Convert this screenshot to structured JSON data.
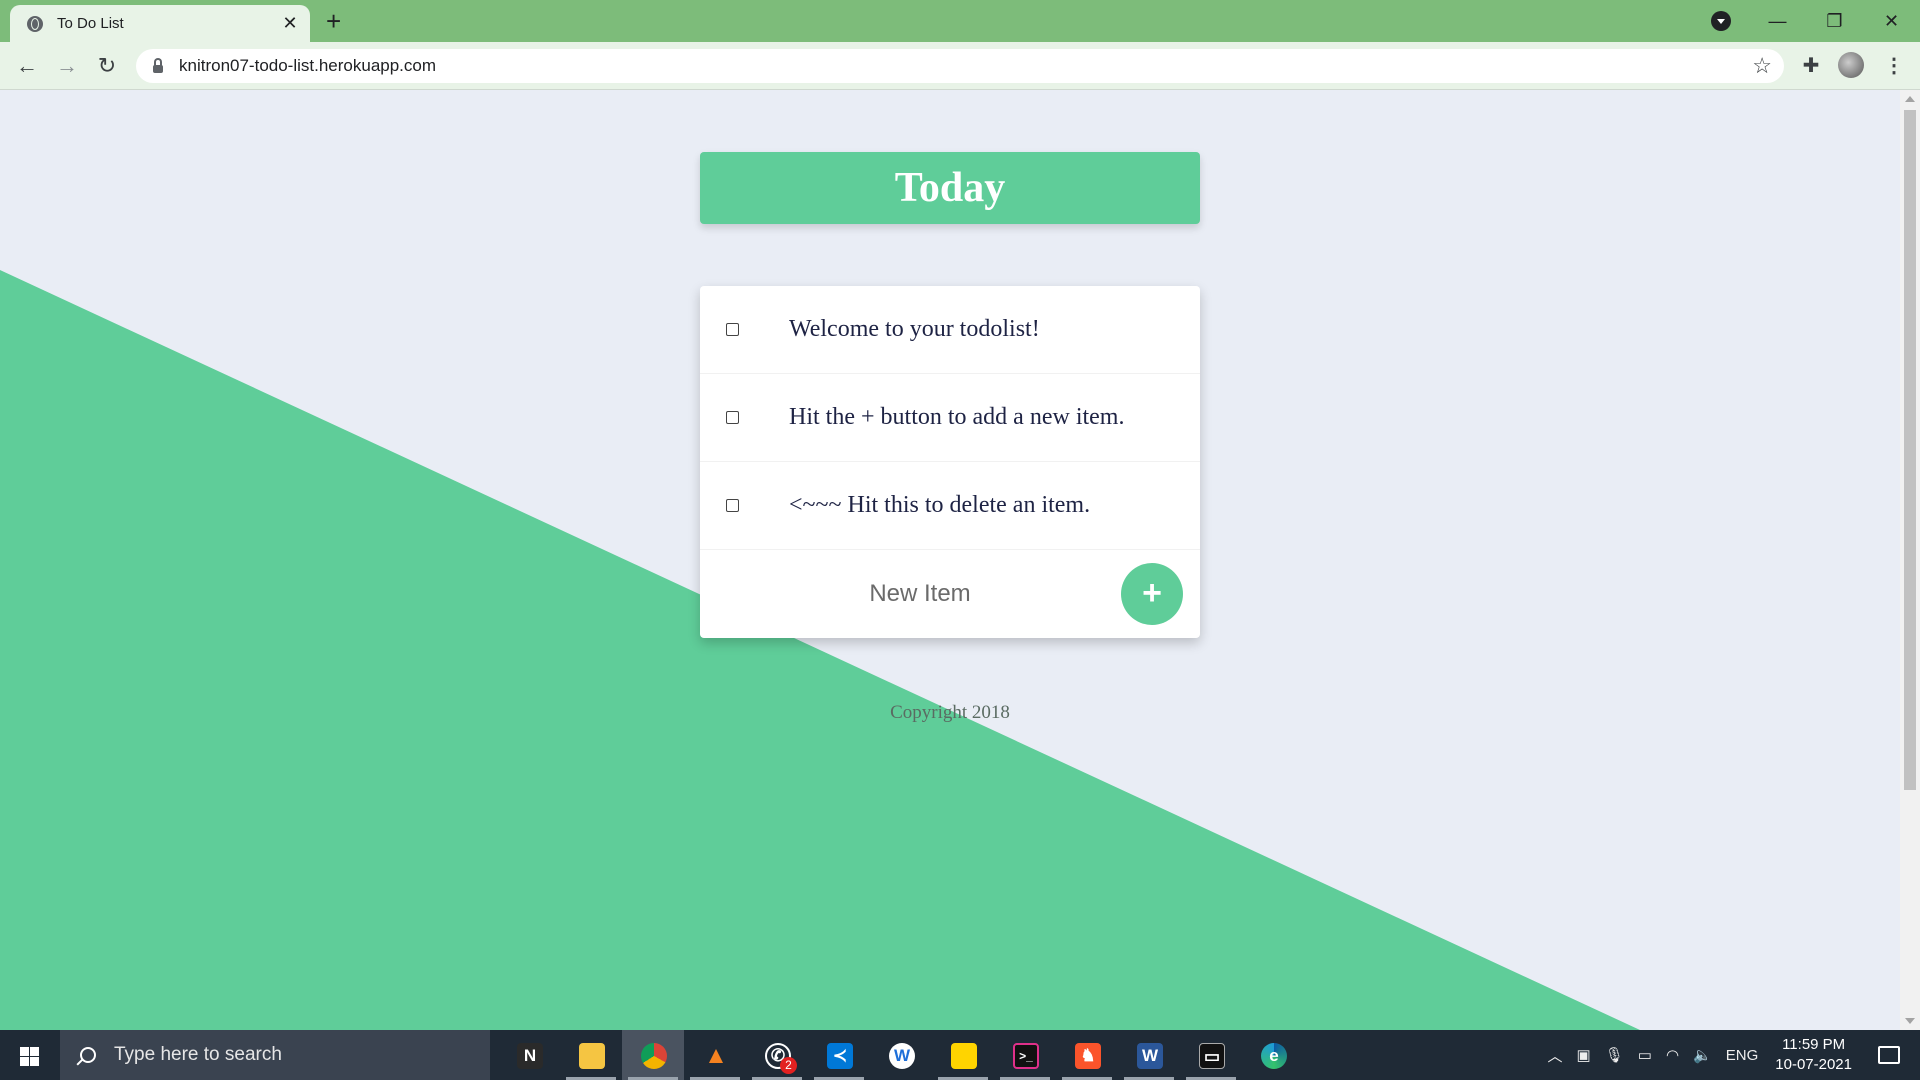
{
  "browser": {
    "tab_title": "To Do List",
    "tab_close": "✕",
    "new_tab": "+",
    "url": "knitron07-todo-list.herokuapp.com",
    "window_controls": {
      "minimize": "—",
      "restore": "❐",
      "close": "✕"
    }
  },
  "app": {
    "title": "Today",
    "items": [
      {
        "text": "Welcome to your todolist!",
        "checked": false
      },
      {
        "text": "Hit the + button to add a new item.",
        "checked": false
      },
      {
        "text": "<~~~ Hit this to delete an item.",
        "checked": false
      }
    ],
    "new_item_placeholder": "New Item",
    "add_button": "+",
    "footer": "Copyright 2018"
  },
  "colors": {
    "accent": "#5fcd99",
    "page_bg": "#e9edf5",
    "chrome": "#7dbc7a"
  },
  "taskbar": {
    "search_placeholder": "Type here to search",
    "apps": [
      {
        "name": "notion-icon",
        "glyph": "N",
        "color": "#2a2a2a"
      },
      {
        "name": "file-explorer-icon",
        "glyph": "",
        "color": "#f5c542"
      },
      {
        "name": "chrome-icon",
        "glyph": "",
        "color": "#db4437"
      },
      {
        "name": "vlc-icon",
        "glyph": "▲",
        "color": "transparent"
      },
      {
        "name": "whatsapp-icon",
        "glyph": "✆",
        "color": "#25d366",
        "badge": "2"
      },
      {
        "name": "vscode-icon",
        "glyph": "≺",
        "color": "#0078d7"
      },
      {
        "name": "app-w-icon",
        "glyph": "W",
        "color": "#ffffff"
      },
      {
        "name": "sticky-notes-icon",
        "glyph": "",
        "color": "#ffd400"
      },
      {
        "name": "terminal-icon",
        "glyph": ">_",
        "color": "#111111"
      },
      {
        "name": "brave-icon",
        "glyph": "♞",
        "color": "#fb542b"
      },
      {
        "name": "word-icon",
        "glyph": "W",
        "color": "#2b579a"
      },
      {
        "name": "cmd-icon",
        "glyph": "▭",
        "color": "#111111"
      },
      {
        "name": "edge-icon",
        "glyph": "e",
        "color": "#1e9bd7"
      }
    ],
    "language": "ENG",
    "time": "11:59 PM",
    "date": "10-07-2021"
  }
}
